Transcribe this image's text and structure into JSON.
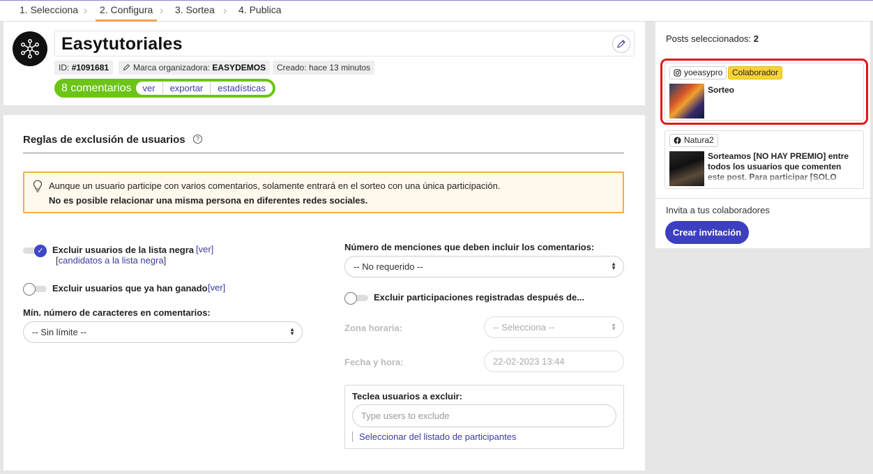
{
  "steps": [
    "1. Selecciona",
    "2. Configura",
    "3. Sortea",
    "4. Publica"
  ],
  "header": {
    "title": "Easytutoriales",
    "id_label": "ID:",
    "id_value": "#1091681",
    "brand_label": "Marca organizadora:",
    "brand_value": "EASYDEMOS",
    "created": "Creado: hace 13 minutos",
    "comments_count": "8 comentarios",
    "links": [
      "ver",
      "exportar",
      "estadísticas"
    ]
  },
  "rules": {
    "title": "Reglas de exclusión de usuarios",
    "help": "?",
    "notice_line1": "Aunque un usuario participe con varios comentarios, solamente entrará en el sorteo con una única participación.",
    "notice_line2": "No es posible relacionar una misma persona en diferentes redes sociales.",
    "blacklist_label": "Excluir usuarios de la lista negra",
    "blacklist_on": true,
    "ver_link": "[ver]",
    "candidates_link": "candidatos a la lista negra",
    "winners_label": "Excluir usuarios que ya han ganado",
    "winners_on": false,
    "min_chars_label": "Mín. número de caracteres en comentarios:",
    "min_chars_value": "-- Sin límite --",
    "mentions_label": "Número de menciones que deben incluir los comentarios:",
    "mentions_value": "-- No requerido --",
    "after_label": "Excluir participaciones registradas después de...",
    "after_on": false,
    "tz_label": "Zona horaria:",
    "tz_value": "-- Selecciona --",
    "datetime_label": "Fecha y hora:",
    "datetime_value": "22-02-2023 13:44",
    "exclude_users_title": "Teclea usuarios a excluir:",
    "exclude_users_placeholder": "Type users to exclude",
    "select_from_list": "Seleccionar del listado de participantes"
  },
  "sidebar": {
    "posts_label": "Posts seleccionados:",
    "posts_count": "2",
    "posts": [
      {
        "network": "instagram",
        "user": "yoeasypro",
        "badge": "Colaborador",
        "text": "Sorteo"
      },
      {
        "network": "facebook",
        "user": "Natura2",
        "text": "Sorteamos [NO HAY PREMIO] entre todos los usuarios que comenten este post. Para participar [SOLO"
      }
    ],
    "invite_label": "Invita a tus colaboradores",
    "invite_button": "Crear invitación"
  },
  "colors": {
    "accent": "#3c3fbf",
    "green": "#6cc417",
    "highlight": "#e21818",
    "warning": "#f0b040"
  }
}
